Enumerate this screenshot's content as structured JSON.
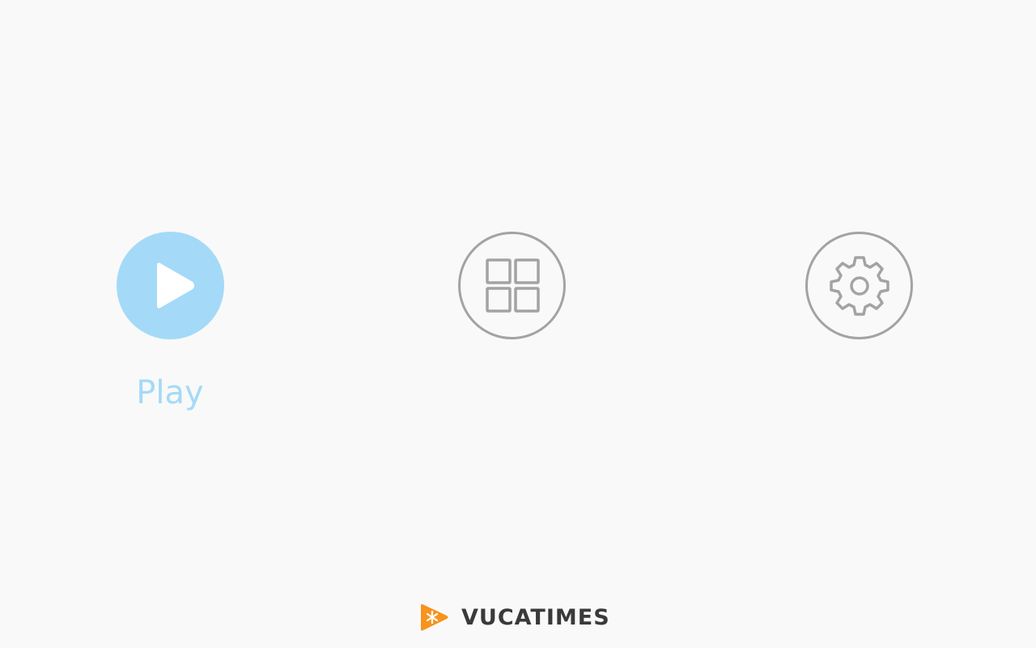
{
  "menu": {
    "play": {
      "label": "Play",
      "icon": "play-icon",
      "color": "#a4daf7",
      "selected": true
    },
    "grid": {
      "icon": "grid-icon",
      "color": "#a3a3a3",
      "selected": false
    },
    "settings": {
      "icon": "gear-icon",
      "color": "#a3a3a3",
      "selected": false
    }
  },
  "brand": {
    "name": "VUCATIMES",
    "logo_icon": "vucatimes-logo-icon",
    "logo_color": "#f7931e"
  },
  "colors": {
    "background": "#f9f9f9",
    "accent": "#a4daf7",
    "icon_gray": "#a3a3a3",
    "brand_text": "#3a3a3a"
  }
}
